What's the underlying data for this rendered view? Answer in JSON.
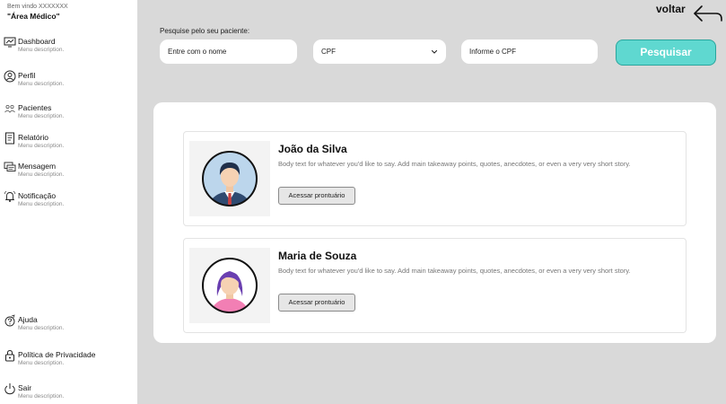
{
  "sidebar": {
    "welcome": "Bem vindo XXXXXXX",
    "area": "\"Área Médico\"",
    "items": [
      {
        "label": "Dashboard",
        "desc": "Menu description."
      },
      {
        "label": "Perfil",
        "desc": "Menu description."
      },
      {
        "label": "Pacientes",
        "desc": "Menu description."
      },
      {
        "label": "Relatório",
        "desc": "Menu description."
      },
      {
        "label": "Mensagem",
        "desc": "Menu description."
      },
      {
        "label": "Notificação",
        "desc": "Menu description."
      }
    ],
    "bottom_items": [
      {
        "label": "Ajuda",
        "desc": "Menu description."
      },
      {
        "label": "Política de Privacidade",
        "desc": "Menu description."
      },
      {
        "label": "Sair",
        "desc": "Menu description."
      }
    ]
  },
  "header": {
    "back_label": "voltar"
  },
  "search": {
    "title": "Pesquise pelo seu paciente:",
    "name_placeholder": "Entre com o nome",
    "type_value": "CPF",
    "cpf_placeholder": "Informe o CPF",
    "button_label": "Pesquisar"
  },
  "results": [
    {
      "name": "João da Silva",
      "body": "Body text for whatever you'd like to say. Add main takeaway points, quotes, anecdotes, or even a very very short story.",
      "button": "Acessar prontuário"
    },
    {
      "name": "Maria de Souza",
      "body": "Body text for whatever you'd like to say. Add main takeaway points, quotes, anecdotes, or even a very very short story.",
      "button": "Acessar prontuário"
    }
  ],
  "colors": {
    "accent": "#5fd8d0",
    "background": "#d9d9d9",
    "panel": "#ffffff"
  },
  "icons": {
    "nav": [
      "dashboard-icon",
      "profile-icon",
      "patients-icon",
      "report-icon",
      "message-icon",
      "bell-icon"
    ],
    "bottom": [
      "help-icon",
      "lock-icon",
      "power-icon"
    ],
    "back": "arrow-left-icon"
  }
}
